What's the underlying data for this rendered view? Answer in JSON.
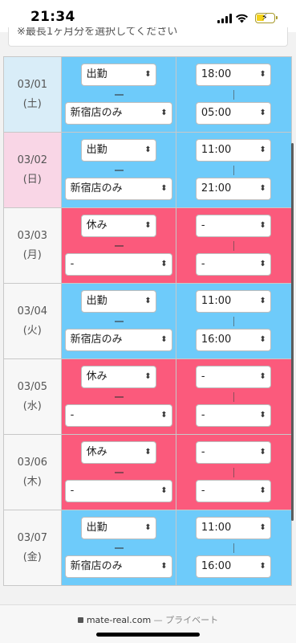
{
  "status": {
    "time": "21:34"
  },
  "topnote": "※最長1ヶ月分を選択してください",
  "rows": [
    {
      "date": "03/01",
      "day": "(土)",
      "status": "出勤",
      "store": "新宿店のみ",
      "start": "18:00",
      "end": "05:00",
      "kind": "work",
      "daytype": "sat"
    },
    {
      "date": "03/02",
      "day": "(日)",
      "status": "出勤",
      "store": "新宿店のみ",
      "start": "11:00",
      "end": "21:00",
      "kind": "work",
      "daytype": "sun"
    },
    {
      "date": "03/03",
      "day": "(月)",
      "status": "休み",
      "store": "-",
      "start": "-",
      "end": "-",
      "kind": "off",
      "daytype": "wk"
    },
    {
      "date": "03/04",
      "day": "(火)",
      "status": "出勤",
      "store": "新宿店のみ",
      "start": "11:00",
      "end": "16:00",
      "kind": "work",
      "daytype": "wk"
    },
    {
      "date": "03/05",
      "day": "(水)",
      "status": "休み",
      "store": "-",
      "start": "-",
      "end": "-",
      "kind": "off",
      "daytype": "wk"
    },
    {
      "date": "03/06",
      "day": "(木)",
      "status": "休み",
      "store": "-",
      "start": "-",
      "end": "-",
      "kind": "off",
      "daytype": "wk"
    },
    {
      "date": "03/07",
      "day": "(金)",
      "status": "出勤",
      "store": "新宿店のみ",
      "start": "11:00",
      "end": "16:00",
      "kind": "work",
      "daytype": "wk"
    }
  ],
  "footer": {
    "domain": "mate-real.com",
    "label": "— プライベート"
  },
  "colors": {
    "work": "#6ecbfa",
    "off": "#fb5a7c",
    "saturday": "#d9edf8",
    "sunday": "#f9d6e6"
  }
}
